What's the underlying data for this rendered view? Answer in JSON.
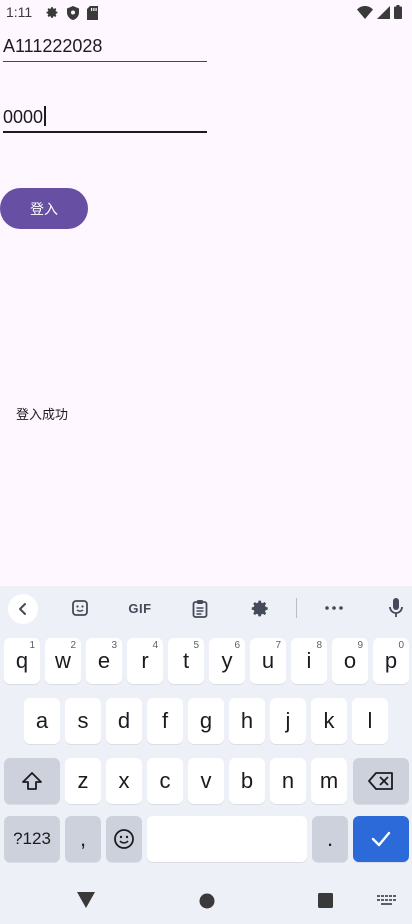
{
  "status_bar": {
    "time": "1:11",
    "left_icons": [
      "gear-icon",
      "shield-icon",
      "sd-card-icon"
    ],
    "right_icons": [
      "wifi-icon",
      "signal-icon",
      "battery-icon"
    ]
  },
  "form": {
    "account_value": "A111222028",
    "password_value": "0000",
    "login_label": "登入",
    "result_message": "登入成功"
  },
  "keyboard": {
    "toolbar": [
      "back-arrow-icon",
      "sticker-icon",
      "gif",
      "clipboard-icon",
      "settings-icon",
      "more-icon",
      "mic-icon"
    ],
    "gif_label": "GIF",
    "row1": [
      {
        "k": "q",
        "h": "1"
      },
      {
        "k": "w",
        "h": "2"
      },
      {
        "k": "e",
        "h": "3"
      },
      {
        "k": "r",
        "h": "4"
      },
      {
        "k": "t",
        "h": "5"
      },
      {
        "k": "y",
        "h": "6"
      },
      {
        "k": "u",
        "h": "7"
      },
      {
        "k": "i",
        "h": "8"
      },
      {
        "k": "o",
        "h": "9"
      },
      {
        "k": "p",
        "h": "0"
      }
    ],
    "row2": [
      "a",
      "s",
      "d",
      "f",
      "g",
      "h",
      "j",
      "k",
      "l"
    ],
    "row3": [
      "z",
      "x",
      "c",
      "v",
      "b",
      "n",
      "m"
    ],
    "symbols_label": "?123",
    "comma_label": ",",
    "period_label": ".",
    "accent_color": "#2b6ad8"
  },
  "nav_bar": {
    "icons": [
      "back-triangle-icon",
      "home-circle-icon",
      "recents-square-icon",
      "keyboard-switch-icon"
    ]
  },
  "colors": {
    "background": "#fef7ff",
    "primary": "#6750a4"
  }
}
